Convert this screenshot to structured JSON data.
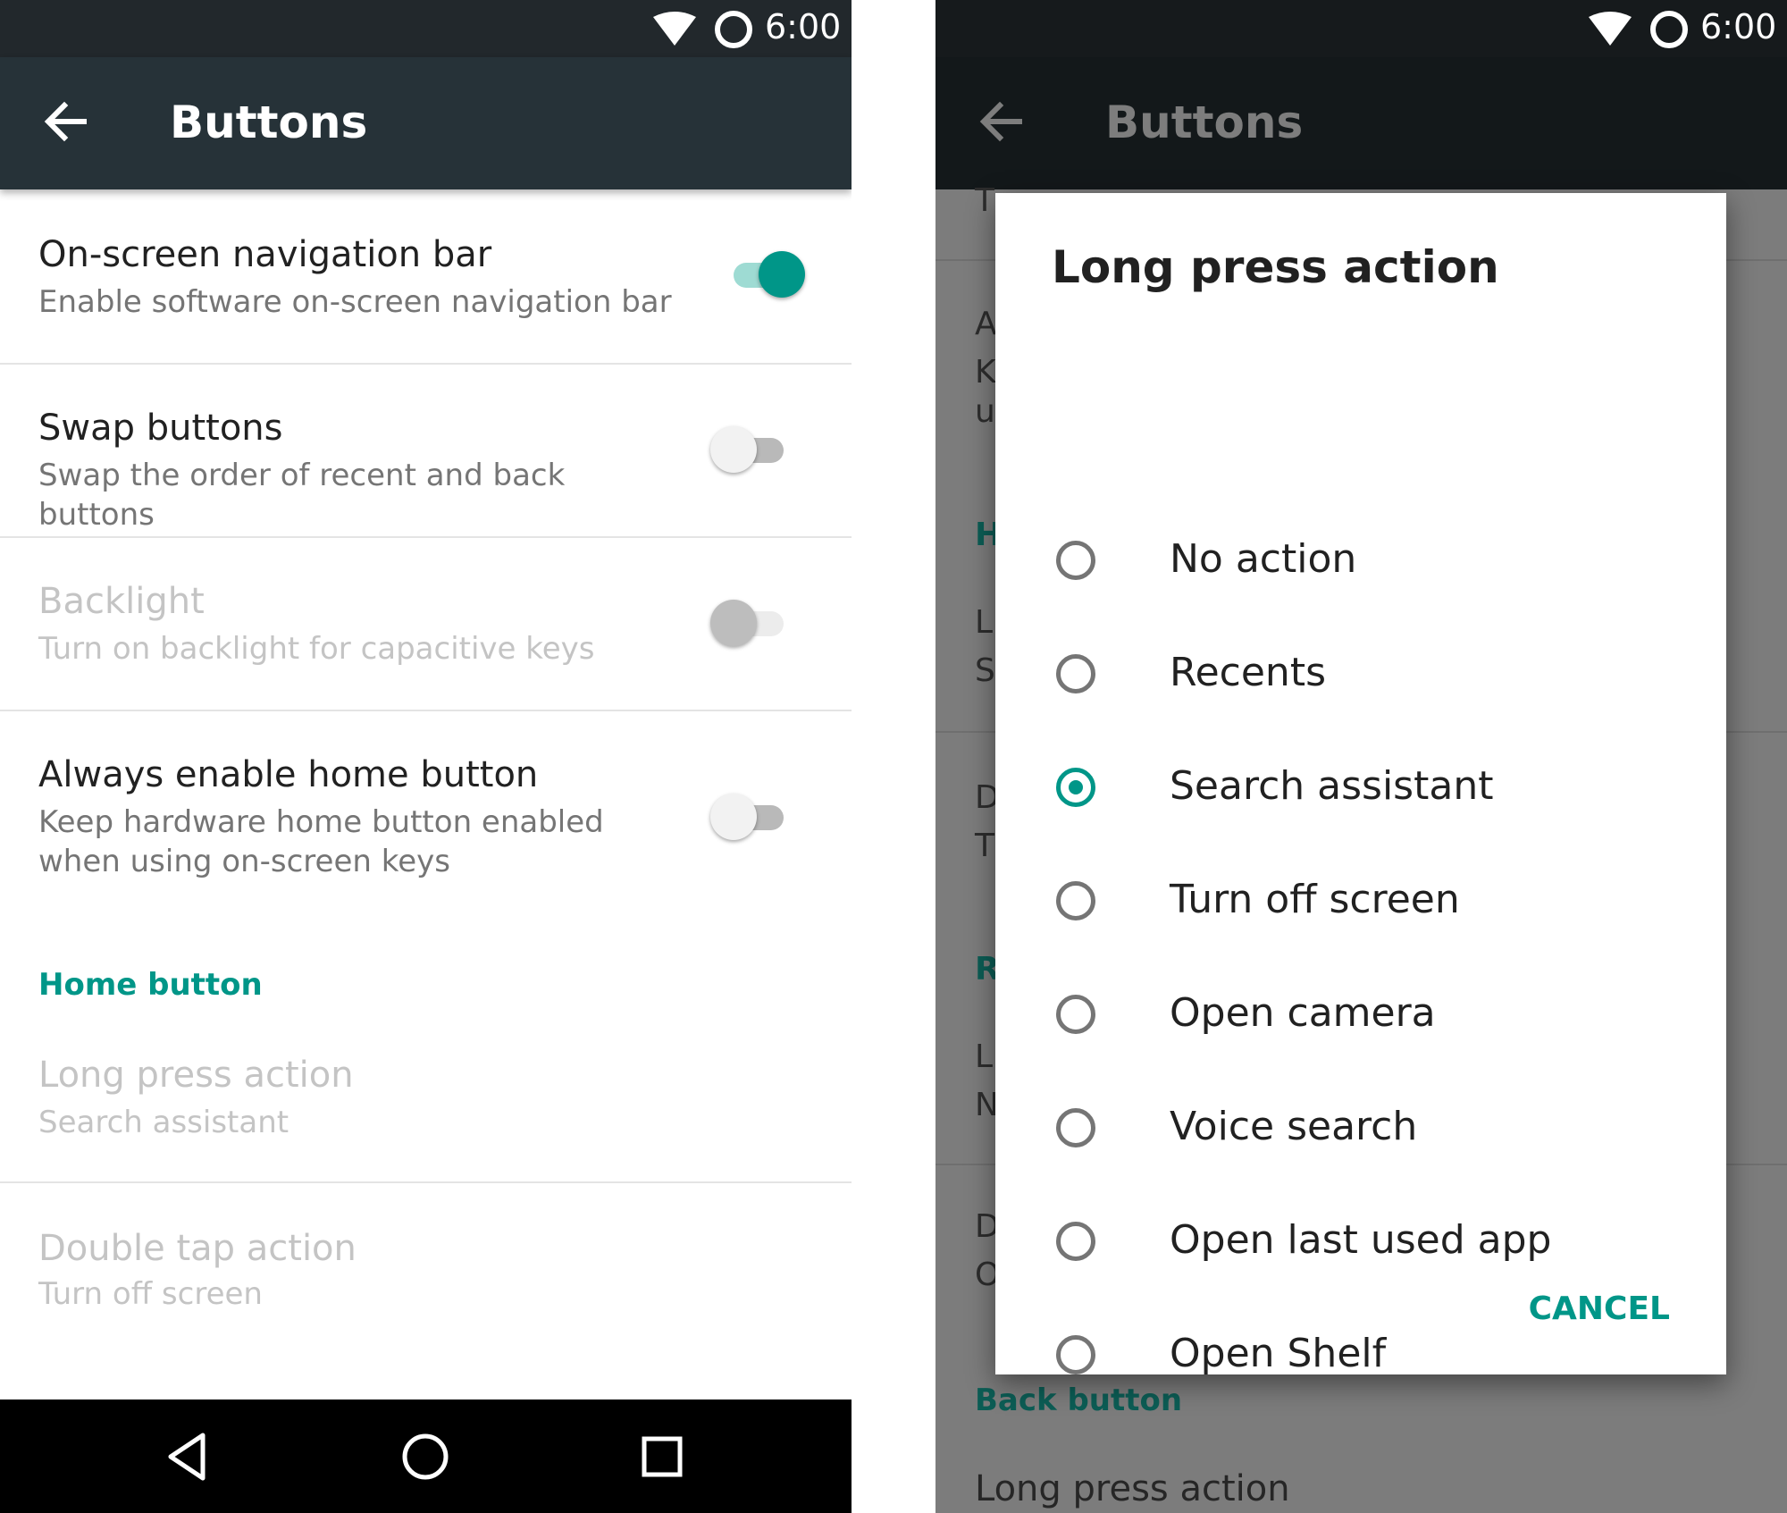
{
  "status_bar": {
    "time": "6:00"
  },
  "left_screen": {
    "toolbar": {
      "title": "Buttons"
    },
    "settings": [
      {
        "title": "On-screen navigation bar",
        "summary": "Enable software on-screen navigation bar",
        "switch": "on",
        "enabled": true
      },
      {
        "title": "Swap buttons",
        "summary": "Swap the order of recent and back buttons",
        "switch": "off",
        "enabled": true
      },
      {
        "title": "Backlight",
        "summary": "Turn on backlight for capacitive keys",
        "switch": "off",
        "enabled": false
      },
      {
        "title": "Always enable home button",
        "summary": "Keep hardware home button enabled when using on-screen keys",
        "switch": "off",
        "enabled": true
      }
    ],
    "section_header": "Home button",
    "home_items": [
      {
        "title": "Long press action",
        "summary": "Search assistant",
        "enabled": false
      },
      {
        "title": "Double tap action",
        "summary": "Turn off screen",
        "enabled": false
      }
    ],
    "nav_icons": [
      "back-icon",
      "home-icon",
      "recents-icon"
    ]
  },
  "right_screen": {
    "toolbar": {
      "title": "Buttons"
    },
    "background_fragments": [
      "T",
      "A",
      "K",
      "u",
      "H",
      "L",
      "S",
      "D",
      "T",
      "R",
      "L",
      "N",
      "D",
      "O"
    ],
    "background_section": "Back button",
    "background_row": "Long press action",
    "dialog": {
      "title": "Long press action",
      "selected": "Search assistant",
      "options": [
        "No action",
        "Recents",
        "Search assistant",
        "Turn off screen",
        "Open camera",
        "Voice search",
        "Open last used app",
        "Open Shelf"
      ],
      "cancel_label": "CANCEL"
    }
  },
  "colors": {
    "accent": "#009688",
    "toolbar": "#263238",
    "status_bar": "#22282c"
  }
}
